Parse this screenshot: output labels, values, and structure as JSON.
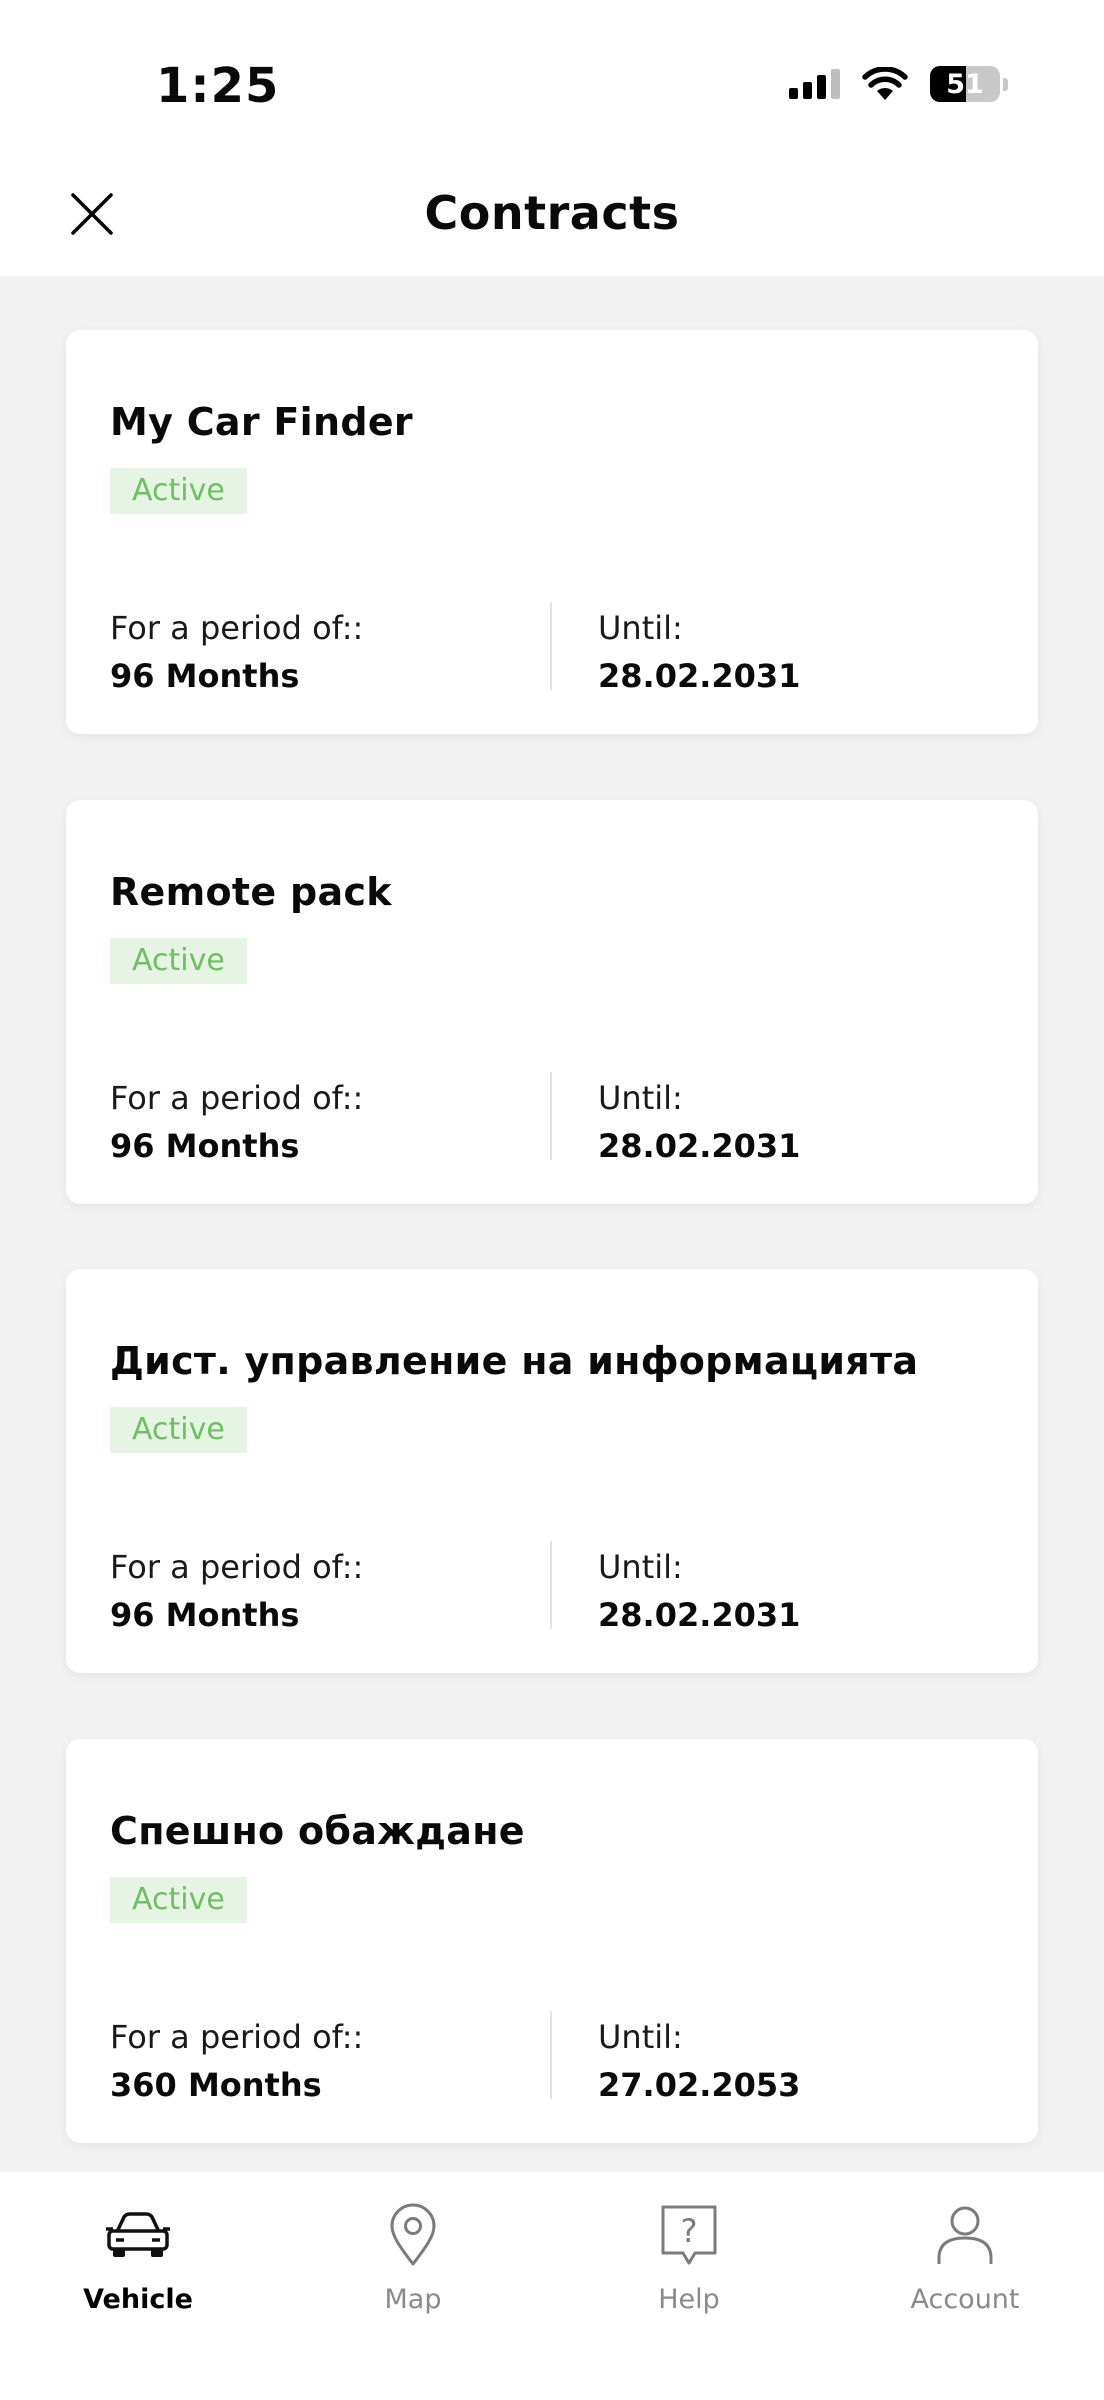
{
  "status_bar": {
    "time": "1:25",
    "battery": "51"
  },
  "header": {
    "title": "Contracts"
  },
  "contracts": [
    {
      "title": "My Car Finder",
      "status": "Active",
      "period_label": "For a period of::",
      "period_value": "96 Months",
      "until_label": "Until:",
      "until_value": "28.02.2031"
    },
    {
      "title": "Remote pack",
      "status": "Active",
      "period_label": "For a period of::",
      "period_value": "96 Months",
      "until_label": "Until:",
      "until_value": "28.02.2031"
    },
    {
      "title": "Дист. управление на информацията",
      "status": "Active",
      "period_label": "For a period of::",
      "period_value": "96 Months",
      "until_label": "Until:",
      "until_value": "28.02.2031"
    },
    {
      "title": "Спешно обаждане",
      "status": "Active",
      "period_label": "For a period of::",
      "period_value": "360 Months",
      "until_label": "Until:",
      "until_value": "27.02.2053"
    }
  ],
  "tabs": [
    {
      "label": "Vehicle",
      "icon": "car-icon",
      "active": true
    },
    {
      "label": "Map",
      "icon": "map-pin-icon",
      "active": false
    },
    {
      "label": "Help",
      "icon": "help-icon",
      "active": false
    },
    {
      "label": "Account",
      "icon": "account-icon",
      "active": false
    }
  ],
  "colors": {
    "badge_bg": "#e6f5e3",
    "badge_text": "#6fbe63",
    "background": "#f2f2f2"
  }
}
